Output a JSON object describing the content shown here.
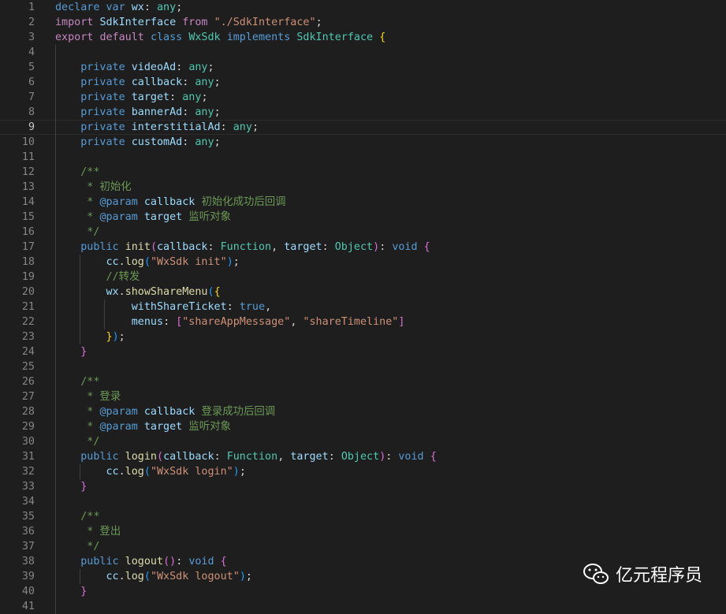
{
  "editor": {
    "lines": [
      {
        "n": "1",
        "tokens": [
          [
            "k",
            "declare "
          ],
          [
            "k",
            "var "
          ],
          [
            "v",
            "wx"
          ],
          [
            "p",
            ": "
          ],
          [
            "t",
            "any"
          ],
          [
            "p",
            ";"
          ]
        ]
      },
      {
        "n": "2",
        "tokens": [
          [
            "kc",
            "import "
          ],
          [
            "v",
            "SdkInterface "
          ],
          [
            "kc",
            "from "
          ],
          [
            "s",
            "\"./SdkInterface\""
          ],
          [
            "p",
            ";"
          ]
        ]
      },
      {
        "n": "3",
        "tokens": [
          [
            "kc",
            "export "
          ],
          [
            "kc",
            "default "
          ],
          [
            "k",
            "class "
          ],
          [
            "t",
            "WxSdk "
          ],
          [
            "k",
            "implements "
          ],
          [
            "t",
            "SdkInterface "
          ],
          [
            "b",
            "{"
          ]
        ]
      },
      {
        "n": "4",
        "tokens": []
      },
      {
        "n": "5",
        "tokens": [
          [
            "p",
            "    "
          ],
          [
            "k",
            "private "
          ],
          [
            "v",
            "videoAd"
          ],
          [
            "p",
            ": "
          ],
          [
            "t",
            "any"
          ],
          [
            "p",
            ";"
          ]
        ]
      },
      {
        "n": "6",
        "tokens": [
          [
            "p",
            "    "
          ],
          [
            "k",
            "private "
          ],
          [
            "v",
            "callback"
          ],
          [
            "p",
            ": "
          ],
          [
            "t",
            "any"
          ],
          [
            "p",
            ";"
          ]
        ]
      },
      {
        "n": "7",
        "tokens": [
          [
            "p",
            "    "
          ],
          [
            "k",
            "private "
          ],
          [
            "v",
            "target"
          ],
          [
            "p",
            ": "
          ],
          [
            "t",
            "any"
          ],
          [
            "p",
            ";"
          ]
        ]
      },
      {
        "n": "8",
        "tokens": [
          [
            "p",
            "    "
          ],
          [
            "k",
            "private "
          ],
          [
            "v",
            "bannerAd"
          ],
          [
            "p",
            ": "
          ],
          [
            "t",
            "any"
          ],
          [
            "p",
            ";"
          ]
        ]
      },
      {
        "n": "9",
        "tokens": [
          [
            "p",
            "    "
          ],
          [
            "k",
            "private "
          ],
          [
            "v",
            "interstitialAd"
          ],
          [
            "p",
            ": "
          ],
          [
            "t",
            "any"
          ],
          [
            "p",
            ";"
          ]
        ]
      },
      {
        "n": "10",
        "tokens": [
          [
            "p",
            "    "
          ],
          [
            "k",
            "private "
          ],
          [
            "v",
            "customAd"
          ],
          [
            "p",
            ": "
          ],
          [
            "t",
            "any"
          ],
          [
            "p",
            ";"
          ]
        ]
      },
      {
        "n": "11",
        "tokens": []
      },
      {
        "n": "12",
        "tokens": [
          [
            "p",
            "    "
          ],
          [
            "c",
            "/**"
          ]
        ]
      },
      {
        "n": "13",
        "tokens": [
          [
            "p",
            "    "
          ],
          [
            "c",
            " * 初始化"
          ]
        ]
      },
      {
        "n": "14",
        "tokens": [
          [
            "p",
            "    "
          ],
          [
            "c",
            " * "
          ],
          [
            "ct",
            "@param "
          ],
          [
            "v",
            "callback "
          ],
          [
            "c",
            "初始化成功后回调"
          ]
        ]
      },
      {
        "n": "15",
        "tokens": [
          [
            "p",
            "    "
          ],
          [
            "c",
            " * "
          ],
          [
            "ct",
            "@param "
          ],
          [
            "v",
            "target "
          ],
          [
            "c",
            "监听对象"
          ]
        ]
      },
      {
        "n": "16",
        "tokens": [
          [
            "p",
            "    "
          ],
          [
            "c",
            " */"
          ]
        ]
      },
      {
        "n": "17",
        "tokens": [
          [
            "p",
            "    "
          ],
          [
            "k",
            "public "
          ],
          [
            "f",
            "init"
          ],
          [
            "b2",
            "("
          ],
          [
            "v",
            "callback"
          ],
          [
            "p",
            ": "
          ],
          [
            "t",
            "Function"
          ],
          [
            "p",
            ", "
          ],
          [
            "v",
            "target"
          ],
          [
            "p",
            ": "
          ],
          [
            "t",
            "Object"
          ],
          [
            "b2",
            ")"
          ],
          [
            "p",
            ": "
          ],
          [
            "k",
            "void "
          ],
          [
            "b2",
            "{"
          ]
        ]
      },
      {
        "n": "18",
        "tokens": [
          [
            "p",
            "        "
          ],
          [
            "v",
            "cc"
          ],
          [
            "p",
            "."
          ],
          [
            "f",
            "log"
          ],
          [
            "b3",
            "("
          ],
          [
            "s",
            "\"WxSdk init\""
          ],
          [
            "b3",
            ")"
          ],
          [
            "p",
            ";"
          ]
        ]
      },
      {
        "n": "19",
        "tokens": [
          [
            "p",
            "        "
          ],
          [
            "c",
            "//转发"
          ]
        ]
      },
      {
        "n": "20",
        "tokens": [
          [
            "p",
            "        "
          ],
          [
            "v",
            "wx"
          ],
          [
            "p",
            "."
          ],
          [
            "f",
            "showShareMenu"
          ],
          [
            "b3",
            "("
          ],
          [
            "b",
            "{"
          ]
        ]
      },
      {
        "n": "21",
        "tokens": [
          [
            "p",
            "            "
          ],
          [
            "v",
            "withShareTicket"
          ],
          [
            "p",
            ": "
          ],
          [
            "k",
            "true"
          ],
          [
            "p",
            ","
          ]
        ]
      },
      {
        "n": "22",
        "tokens": [
          [
            "p",
            "            "
          ],
          [
            "v",
            "menus"
          ],
          [
            "p",
            ": "
          ],
          [
            "b2",
            "["
          ],
          [
            "s",
            "\"shareAppMessage\""
          ],
          [
            "p",
            ", "
          ],
          [
            "s",
            "\"shareTimeline\""
          ],
          [
            "b2",
            "]"
          ]
        ]
      },
      {
        "n": "23",
        "tokens": [
          [
            "p",
            "        "
          ],
          [
            "b",
            "}"
          ],
          [
            "b3",
            ")"
          ],
          [
            "p",
            ";"
          ]
        ]
      },
      {
        "n": "24",
        "tokens": [
          [
            "p",
            "    "
          ],
          [
            "b2",
            "}"
          ]
        ]
      },
      {
        "n": "25",
        "tokens": []
      },
      {
        "n": "26",
        "tokens": [
          [
            "p",
            "    "
          ],
          [
            "c",
            "/**"
          ]
        ]
      },
      {
        "n": "27",
        "tokens": [
          [
            "p",
            "    "
          ],
          [
            "c",
            " * 登录"
          ]
        ]
      },
      {
        "n": "28",
        "tokens": [
          [
            "p",
            "    "
          ],
          [
            "c",
            " * "
          ],
          [
            "ct",
            "@param "
          ],
          [
            "v",
            "callback "
          ],
          [
            "c",
            "登录成功后回调"
          ]
        ]
      },
      {
        "n": "29",
        "tokens": [
          [
            "p",
            "    "
          ],
          [
            "c",
            " * "
          ],
          [
            "ct",
            "@param "
          ],
          [
            "v",
            "target "
          ],
          [
            "c",
            "监听对象"
          ]
        ]
      },
      {
        "n": "30",
        "tokens": [
          [
            "p",
            "    "
          ],
          [
            "c",
            " */"
          ]
        ]
      },
      {
        "n": "31",
        "tokens": [
          [
            "p",
            "    "
          ],
          [
            "k",
            "public "
          ],
          [
            "f",
            "login"
          ],
          [
            "b2",
            "("
          ],
          [
            "v",
            "callback"
          ],
          [
            "p",
            ": "
          ],
          [
            "t",
            "Function"
          ],
          [
            "p",
            ", "
          ],
          [
            "v",
            "target"
          ],
          [
            "p",
            ": "
          ],
          [
            "t",
            "Object"
          ],
          [
            "b2",
            ")"
          ],
          [
            "p",
            ": "
          ],
          [
            "k",
            "void "
          ],
          [
            "b2",
            "{"
          ]
        ]
      },
      {
        "n": "32",
        "tokens": [
          [
            "p",
            "        "
          ],
          [
            "v",
            "cc"
          ],
          [
            "p",
            "."
          ],
          [
            "f",
            "log"
          ],
          [
            "b3",
            "("
          ],
          [
            "s",
            "\"WxSdk login\""
          ],
          [
            "b3",
            ")"
          ],
          [
            "p",
            ";"
          ]
        ]
      },
      {
        "n": "33",
        "tokens": [
          [
            "p",
            "    "
          ],
          [
            "b2",
            "}"
          ]
        ]
      },
      {
        "n": "34",
        "tokens": []
      },
      {
        "n": "35",
        "tokens": [
          [
            "p",
            "    "
          ],
          [
            "c",
            "/**"
          ]
        ]
      },
      {
        "n": "36",
        "tokens": [
          [
            "p",
            "    "
          ],
          [
            "c",
            " * 登出"
          ]
        ]
      },
      {
        "n": "37",
        "tokens": [
          [
            "p",
            "    "
          ],
          [
            "c",
            " */"
          ]
        ]
      },
      {
        "n": "38",
        "tokens": [
          [
            "p",
            "    "
          ],
          [
            "k",
            "public "
          ],
          [
            "f",
            "logout"
          ],
          [
            "b2",
            "()"
          ],
          [
            "p",
            ": "
          ],
          [
            "k",
            "void "
          ],
          [
            "b2",
            "{"
          ]
        ]
      },
      {
        "n": "39",
        "tokens": [
          [
            "p",
            "        "
          ],
          [
            "v",
            "cc"
          ],
          [
            "p",
            "."
          ],
          [
            "f",
            "log"
          ],
          [
            "b3",
            "("
          ],
          [
            "s",
            "\"WxSdk logout\""
          ],
          [
            "b3",
            ")"
          ],
          [
            "p",
            ";"
          ]
        ]
      },
      {
        "n": "40",
        "tokens": [
          [
            "p",
            "    "
          ],
          [
            "b2",
            "}"
          ]
        ]
      },
      {
        "n": "41",
        "tokens": []
      }
    ],
    "current_line": "9"
  },
  "watermark": {
    "icon": "wechat-icon",
    "text": "亿元程序员"
  },
  "colors": {
    "background": "#1e1e1e",
    "keyword": "#569cd6",
    "type": "#4ec9b0",
    "string": "#ce9178",
    "comment": "#6a9955"
  }
}
